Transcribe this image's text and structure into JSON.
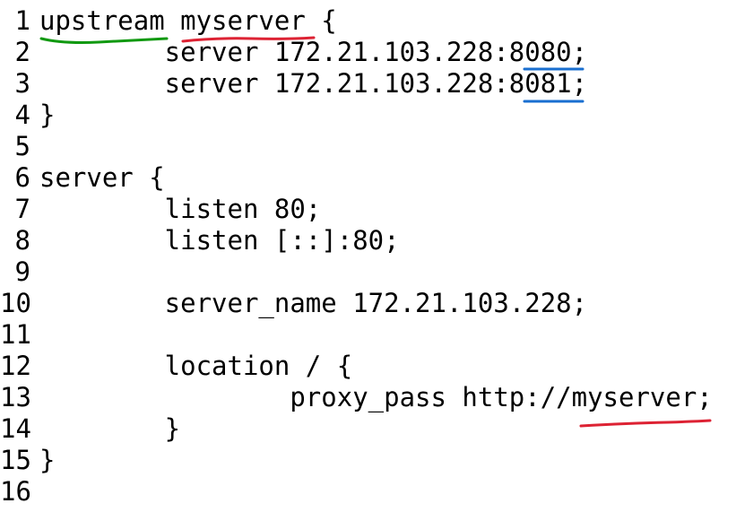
{
  "editor": {
    "lines": [
      {
        "num": "1",
        "text": "upstream myserver {"
      },
      {
        "num": "2",
        "text": "        server 172.21.103.228:8080;"
      },
      {
        "num": "3",
        "text": "        server 172.21.103.228:8081;"
      },
      {
        "num": "4",
        "text": "}"
      },
      {
        "num": "5",
        "text": ""
      },
      {
        "num": "6",
        "text": "server {"
      },
      {
        "num": "7",
        "text": "        listen 80;"
      },
      {
        "num": "8",
        "text": "        listen [::]:80;"
      },
      {
        "num": "9",
        "text": ""
      },
      {
        "num": "10",
        "text": "        server_name 172.21.103.228;"
      },
      {
        "num": "11",
        "text": ""
      },
      {
        "num": "12",
        "text": "        location / {"
      },
      {
        "num": "13",
        "text": "                proxy_pass http://myserver;"
      },
      {
        "num": "14",
        "text": "        }"
      },
      {
        "num": "15",
        "text": "}"
      },
      {
        "num": "16",
        "text": ""
      }
    ]
  },
  "annotations": {
    "green": "#119911",
    "red": "#dd2233",
    "blue": "#1a6fd0"
  }
}
